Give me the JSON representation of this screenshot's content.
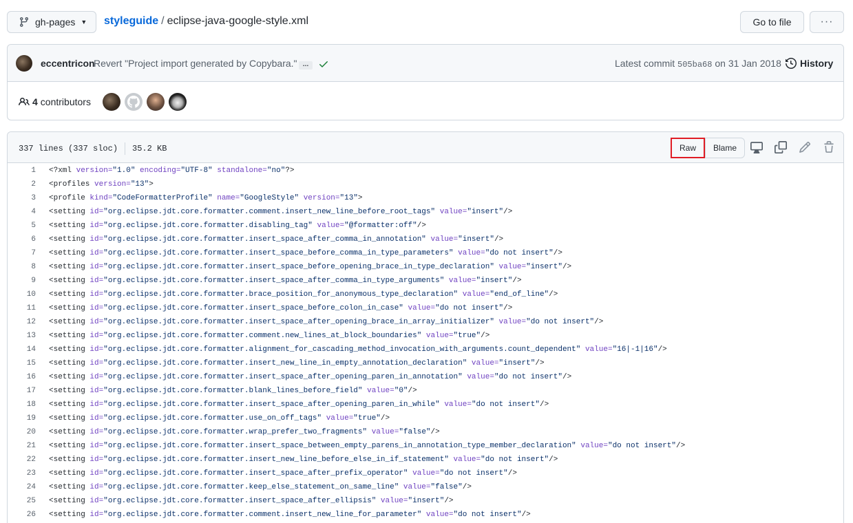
{
  "topbar": {
    "branch": "gh-pages",
    "repo": "styleguide",
    "separator": "/",
    "file": "eclipse-java-google-style.xml",
    "goto_file": "Go to file",
    "more": "···"
  },
  "commit": {
    "author": "eccentricon",
    "message": "Revert \"Project import generated by Copybara.\"",
    "ellipsis": "…",
    "latest_label": "Latest commit",
    "sha": "505ba68",
    "date_prefix": "on",
    "date": "31 Jan 2018",
    "history": "History",
    "status_color": "#1a7f37"
  },
  "contributors": {
    "count": "4",
    "label": "contributors"
  },
  "file_header": {
    "lines": "337 lines (337 sloc)",
    "size": "35.2 KB",
    "raw": "Raw",
    "blame": "Blame",
    "highlight_color": "#e01c24"
  },
  "code_lines": [
    {
      "n": "1",
      "parts": [
        [
          "t",
          "<?xml "
        ],
        [
          "a",
          "version="
        ],
        [
          "v",
          "\"1.0\" "
        ],
        [
          "a",
          "encoding="
        ],
        [
          "v",
          "\"UTF-8\" "
        ],
        [
          "a",
          "standalone="
        ],
        [
          "v",
          "\"no\""
        ],
        [
          "t",
          "?>"
        ]
      ]
    },
    {
      "n": "2",
      "parts": [
        [
          "t",
          "<profiles "
        ],
        [
          "a",
          "version="
        ],
        [
          "v",
          "\"13\""
        ],
        [
          "t",
          ">"
        ]
      ]
    },
    {
      "n": "3",
      "parts": [
        [
          "t",
          "<profile "
        ],
        [
          "a",
          "kind="
        ],
        [
          "v",
          "\"CodeFormatterProfile\" "
        ],
        [
          "a",
          "name="
        ],
        [
          "v",
          "\"GoogleStyle\" "
        ],
        [
          "a",
          "version="
        ],
        [
          "v",
          "\"13\""
        ],
        [
          "t",
          ">"
        ]
      ]
    },
    {
      "n": "4",
      "parts": [
        [
          "t",
          "<setting "
        ],
        [
          "a",
          "id="
        ],
        [
          "v",
          "\"org.eclipse.jdt.core.formatter.comment.insert_new_line_before_root_tags\" "
        ],
        [
          "a",
          "value="
        ],
        [
          "v",
          "\"insert\""
        ],
        [
          "t",
          "/>"
        ]
      ]
    },
    {
      "n": "5",
      "parts": [
        [
          "t",
          "<setting "
        ],
        [
          "a",
          "id="
        ],
        [
          "v",
          "\"org.eclipse.jdt.core.formatter.disabling_tag\" "
        ],
        [
          "a",
          "value="
        ],
        [
          "v",
          "\"@formatter:off\""
        ],
        [
          "t",
          "/>"
        ]
      ]
    },
    {
      "n": "6",
      "parts": [
        [
          "t",
          "<setting "
        ],
        [
          "a",
          "id="
        ],
        [
          "v",
          "\"org.eclipse.jdt.core.formatter.insert_space_after_comma_in_annotation\" "
        ],
        [
          "a",
          "value="
        ],
        [
          "v",
          "\"insert\""
        ],
        [
          "t",
          "/>"
        ]
      ]
    },
    {
      "n": "7",
      "parts": [
        [
          "t",
          "<setting "
        ],
        [
          "a",
          "id="
        ],
        [
          "v",
          "\"org.eclipse.jdt.core.formatter.insert_space_before_comma_in_type_parameters\" "
        ],
        [
          "a",
          "value="
        ],
        [
          "v",
          "\"do not insert\""
        ],
        [
          "t",
          "/>"
        ]
      ]
    },
    {
      "n": "8",
      "parts": [
        [
          "t",
          "<setting "
        ],
        [
          "a",
          "id="
        ],
        [
          "v",
          "\"org.eclipse.jdt.core.formatter.insert_space_before_opening_brace_in_type_declaration\" "
        ],
        [
          "a",
          "value="
        ],
        [
          "v",
          "\"insert\""
        ],
        [
          "t",
          "/>"
        ]
      ]
    },
    {
      "n": "9",
      "parts": [
        [
          "t",
          "<setting "
        ],
        [
          "a",
          "id="
        ],
        [
          "v",
          "\"org.eclipse.jdt.core.formatter.insert_space_after_comma_in_type_arguments\" "
        ],
        [
          "a",
          "value="
        ],
        [
          "v",
          "\"insert\""
        ],
        [
          "t",
          "/>"
        ]
      ]
    },
    {
      "n": "10",
      "parts": [
        [
          "t",
          "<setting "
        ],
        [
          "a",
          "id="
        ],
        [
          "v",
          "\"org.eclipse.jdt.core.formatter.brace_position_for_anonymous_type_declaration\" "
        ],
        [
          "a",
          "value="
        ],
        [
          "v",
          "\"end_of_line\""
        ],
        [
          "t",
          "/>"
        ]
      ]
    },
    {
      "n": "11",
      "parts": [
        [
          "t",
          "<setting "
        ],
        [
          "a",
          "id="
        ],
        [
          "v",
          "\"org.eclipse.jdt.core.formatter.insert_space_before_colon_in_case\" "
        ],
        [
          "a",
          "value="
        ],
        [
          "v",
          "\"do not insert\""
        ],
        [
          "t",
          "/>"
        ]
      ]
    },
    {
      "n": "12",
      "parts": [
        [
          "t",
          "<setting "
        ],
        [
          "a",
          "id="
        ],
        [
          "v",
          "\"org.eclipse.jdt.core.formatter.insert_space_after_opening_brace_in_array_initializer\" "
        ],
        [
          "a",
          "value="
        ],
        [
          "v",
          "\"do not insert\""
        ],
        [
          "t",
          "/>"
        ]
      ]
    },
    {
      "n": "13",
      "parts": [
        [
          "t",
          "<setting "
        ],
        [
          "a",
          "id="
        ],
        [
          "v",
          "\"org.eclipse.jdt.core.formatter.comment.new_lines_at_block_boundaries\" "
        ],
        [
          "a",
          "value="
        ],
        [
          "v",
          "\"true\""
        ],
        [
          "t",
          "/>"
        ]
      ]
    },
    {
      "n": "14",
      "parts": [
        [
          "t",
          "<setting "
        ],
        [
          "a",
          "id="
        ],
        [
          "v",
          "\"org.eclipse.jdt.core.formatter.alignment_for_cascading_method_invocation_with_arguments.count_dependent\" "
        ],
        [
          "a",
          "value="
        ],
        [
          "v",
          "\"16|-1|16\""
        ],
        [
          "t",
          "/>"
        ]
      ]
    },
    {
      "n": "15",
      "parts": [
        [
          "t",
          "<setting "
        ],
        [
          "a",
          "id="
        ],
        [
          "v",
          "\"org.eclipse.jdt.core.formatter.insert_new_line_in_empty_annotation_declaration\" "
        ],
        [
          "a",
          "value="
        ],
        [
          "v",
          "\"insert\""
        ],
        [
          "t",
          "/>"
        ]
      ]
    },
    {
      "n": "16",
      "parts": [
        [
          "t",
          "<setting "
        ],
        [
          "a",
          "id="
        ],
        [
          "v",
          "\"org.eclipse.jdt.core.formatter.insert_space_after_opening_paren_in_annotation\" "
        ],
        [
          "a",
          "value="
        ],
        [
          "v",
          "\"do not insert\""
        ],
        [
          "t",
          "/>"
        ]
      ]
    },
    {
      "n": "17",
      "parts": [
        [
          "t",
          "<setting "
        ],
        [
          "a",
          "id="
        ],
        [
          "v",
          "\"org.eclipse.jdt.core.formatter.blank_lines_before_field\" "
        ],
        [
          "a",
          "value="
        ],
        [
          "v",
          "\"0\""
        ],
        [
          "t",
          "/>"
        ]
      ]
    },
    {
      "n": "18",
      "parts": [
        [
          "t",
          "<setting "
        ],
        [
          "a",
          "id="
        ],
        [
          "v",
          "\"org.eclipse.jdt.core.formatter.insert_space_after_opening_paren_in_while\" "
        ],
        [
          "a",
          "value="
        ],
        [
          "v",
          "\"do not insert\""
        ],
        [
          "t",
          "/>"
        ]
      ]
    },
    {
      "n": "19",
      "parts": [
        [
          "t",
          "<setting "
        ],
        [
          "a",
          "id="
        ],
        [
          "v",
          "\"org.eclipse.jdt.core.formatter.use_on_off_tags\" "
        ],
        [
          "a",
          "value="
        ],
        [
          "v",
          "\"true\""
        ],
        [
          "t",
          "/>"
        ]
      ]
    },
    {
      "n": "20",
      "parts": [
        [
          "t",
          "<setting "
        ],
        [
          "a",
          "id="
        ],
        [
          "v",
          "\"org.eclipse.jdt.core.formatter.wrap_prefer_two_fragments\" "
        ],
        [
          "a",
          "value="
        ],
        [
          "v",
          "\"false\""
        ],
        [
          "t",
          "/>"
        ]
      ]
    },
    {
      "n": "21",
      "parts": [
        [
          "t",
          "<setting "
        ],
        [
          "a",
          "id="
        ],
        [
          "v",
          "\"org.eclipse.jdt.core.formatter.insert_space_between_empty_parens_in_annotation_type_member_declaration\" "
        ],
        [
          "a",
          "value="
        ],
        [
          "v",
          "\"do not insert\""
        ],
        [
          "t",
          "/>"
        ]
      ]
    },
    {
      "n": "22",
      "parts": [
        [
          "t",
          "<setting "
        ],
        [
          "a",
          "id="
        ],
        [
          "v",
          "\"org.eclipse.jdt.core.formatter.insert_new_line_before_else_in_if_statement\" "
        ],
        [
          "a",
          "value="
        ],
        [
          "v",
          "\"do not insert\""
        ],
        [
          "t",
          "/>"
        ]
      ]
    },
    {
      "n": "23",
      "parts": [
        [
          "t",
          "<setting "
        ],
        [
          "a",
          "id="
        ],
        [
          "v",
          "\"org.eclipse.jdt.core.formatter.insert_space_after_prefix_operator\" "
        ],
        [
          "a",
          "value="
        ],
        [
          "v",
          "\"do not insert\""
        ],
        [
          "t",
          "/>"
        ]
      ]
    },
    {
      "n": "24",
      "parts": [
        [
          "t",
          "<setting "
        ],
        [
          "a",
          "id="
        ],
        [
          "v",
          "\"org.eclipse.jdt.core.formatter.keep_else_statement_on_same_line\" "
        ],
        [
          "a",
          "value="
        ],
        [
          "v",
          "\"false\""
        ],
        [
          "t",
          "/>"
        ]
      ]
    },
    {
      "n": "25",
      "parts": [
        [
          "t",
          "<setting "
        ],
        [
          "a",
          "id="
        ],
        [
          "v",
          "\"org.eclipse.jdt.core.formatter.insert_space_after_ellipsis\" "
        ],
        [
          "a",
          "value="
        ],
        [
          "v",
          "\"insert\""
        ],
        [
          "t",
          "/>"
        ]
      ]
    },
    {
      "n": "26",
      "parts": [
        [
          "t",
          "<setting "
        ],
        [
          "a",
          "id="
        ],
        [
          "v",
          "\"org.eclipse.jdt.core.formatter.comment.insert_new_line_for_parameter\" "
        ],
        [
          "a",
          "value="
        ],
        [
          "v",
          "\"do not insert\""
        ],
        [
          "t",
          "/>"
        ]
      ]
    }
  ]
}
